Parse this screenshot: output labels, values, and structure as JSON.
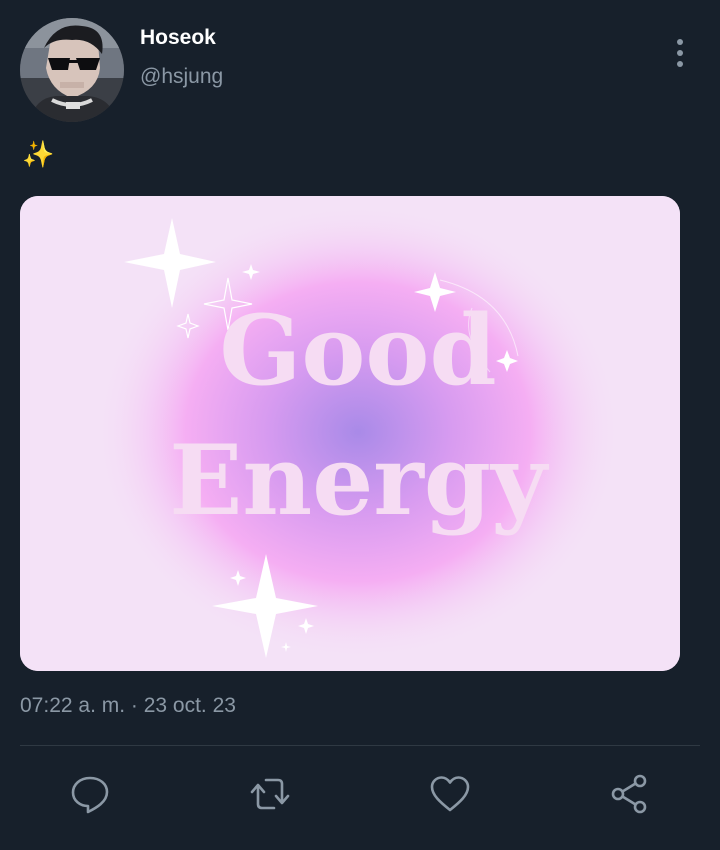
{
  "user": {
    "display_name": "Hoseok",
    "handle": "@hsjung",
    "avatar_icon": "user-avatar-photo"
  },
  "tweet": {
    "text": "✨",
    "timestamp": "07:22 a. m. · 23 oct. 23",
    "media": {
      "image_text": "Good Energy",
      "colors": {
        "background": "#f4e2f7",
        "glow_outer": "#f5aef3",
        "glow_center": "#a98ae8",
        "text": "#f6dcf3"
      }
    }
  },
  "actions": {
    "reply_icon": "reply-icon",
    "retweet_icon": "retweet-icon",
    "like_icon": "heart-icon",
    "share_icon": "share-icon"
  },
  "theme": {
    "background": "#17202b",
    "muted_text": "#8b98a5",
    "icon_color": "#8b98a5"
  }
}
